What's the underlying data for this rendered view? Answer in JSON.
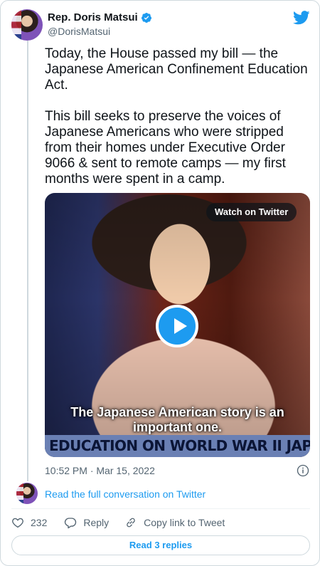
{
  "author": {
    "name": "Rep. Doris Matsui",
    "handle": "@DorisMatsui"
  },
  "tweet": {
    "paragraphs": [
      "Today, the House passed my bill — the Japanese American Confinement Education Act.",
      "This bill seeks to preserve the voices of Japanese Americans who were stripped from their homes under Executive Order 9066 & sent to remote camps — my first months were spent in a camp."
    ],
    "timestamp": "10:52 PM · Mar 15, 2022"
  },
  "media": {
    "watch_label": "Watch on Twitter",
    "caption": "The Japanese American story is an important one.",
    "banner": "EDUCATION ON WORLD WAR II JAPANESE"
  },
  "conversation": {
    "link_label": "Read the full conversation on Twitter"
  },
  "actions": {
    "like_count": "232",
    "reply_label": "Reply",
    "copy_link_label": "Copy link to Tweet"
  },
  "footer": {
    "read_replies_label": "Read 3 replies"
  },
  "icons": {
    "logo": "twitter-bird-icon",
    "verified": "verified-badge-icon",
    "info": "info-icon",
    "like": "heart-icon",
    "reply": "reply-bubble-icon",
    "copy_link": "link-icon",
    "play": "play-icon"
  },
  "colors": {
    "accent": "#1d9bf0",
    "text": "#0f1419",
    "muted": "#536471",
    "border": "#cfd9de"
  }
}
